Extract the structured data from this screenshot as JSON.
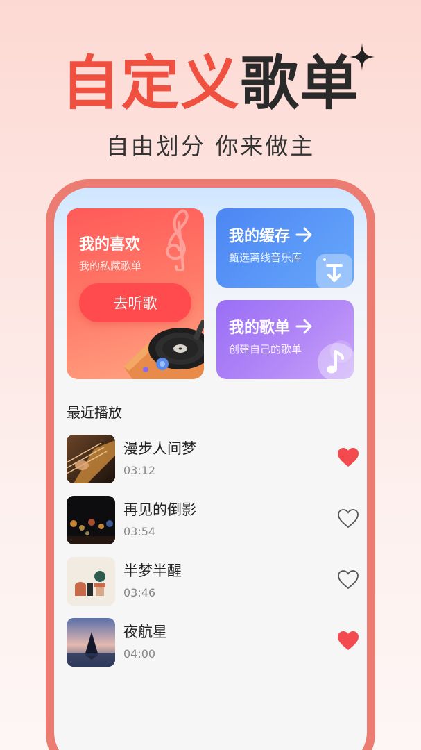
{
  "hero": {
    "title_red": "自定义",
    "title_dark": "歌单",
    "subtitle": "自由划分 你来做主"
  },
  "colors": {
    "accent_red": "#f0503f",
    "phone_frame": "#ec7b72",
    "liked_heart": "#f24a4e"
  },
  "cards": {
    "favorites": {
      "title": "我的喜欢",
      "subtitle": "我的私藏歌单",
      "button": "去听歌"
    },
    "cache": {
      "title": "我的缓存",
      "subtitle": "甄选离线音乐库"
    },
    "playlists": {
      "title": "我的歌单",
      "subtitle": "创建自己的歌单"
    }
  },
  "recent": {
    "title": "最近播放",
    "songs": [
      {
        "name": "漫步人间梦",
        "duration": "03:12",
        "liked": true
      },
      {
        "name": "再见的倒影",
        "duration": "03:54",
        "liked": false
      },
      {
        "name": "半梦半醒",
        "duration": "03:46",
        "liked": false
      },
      {
        "name": "夜航星",
        "duration": "04:00",
        "liked": true
      }
    ]
  }
}
